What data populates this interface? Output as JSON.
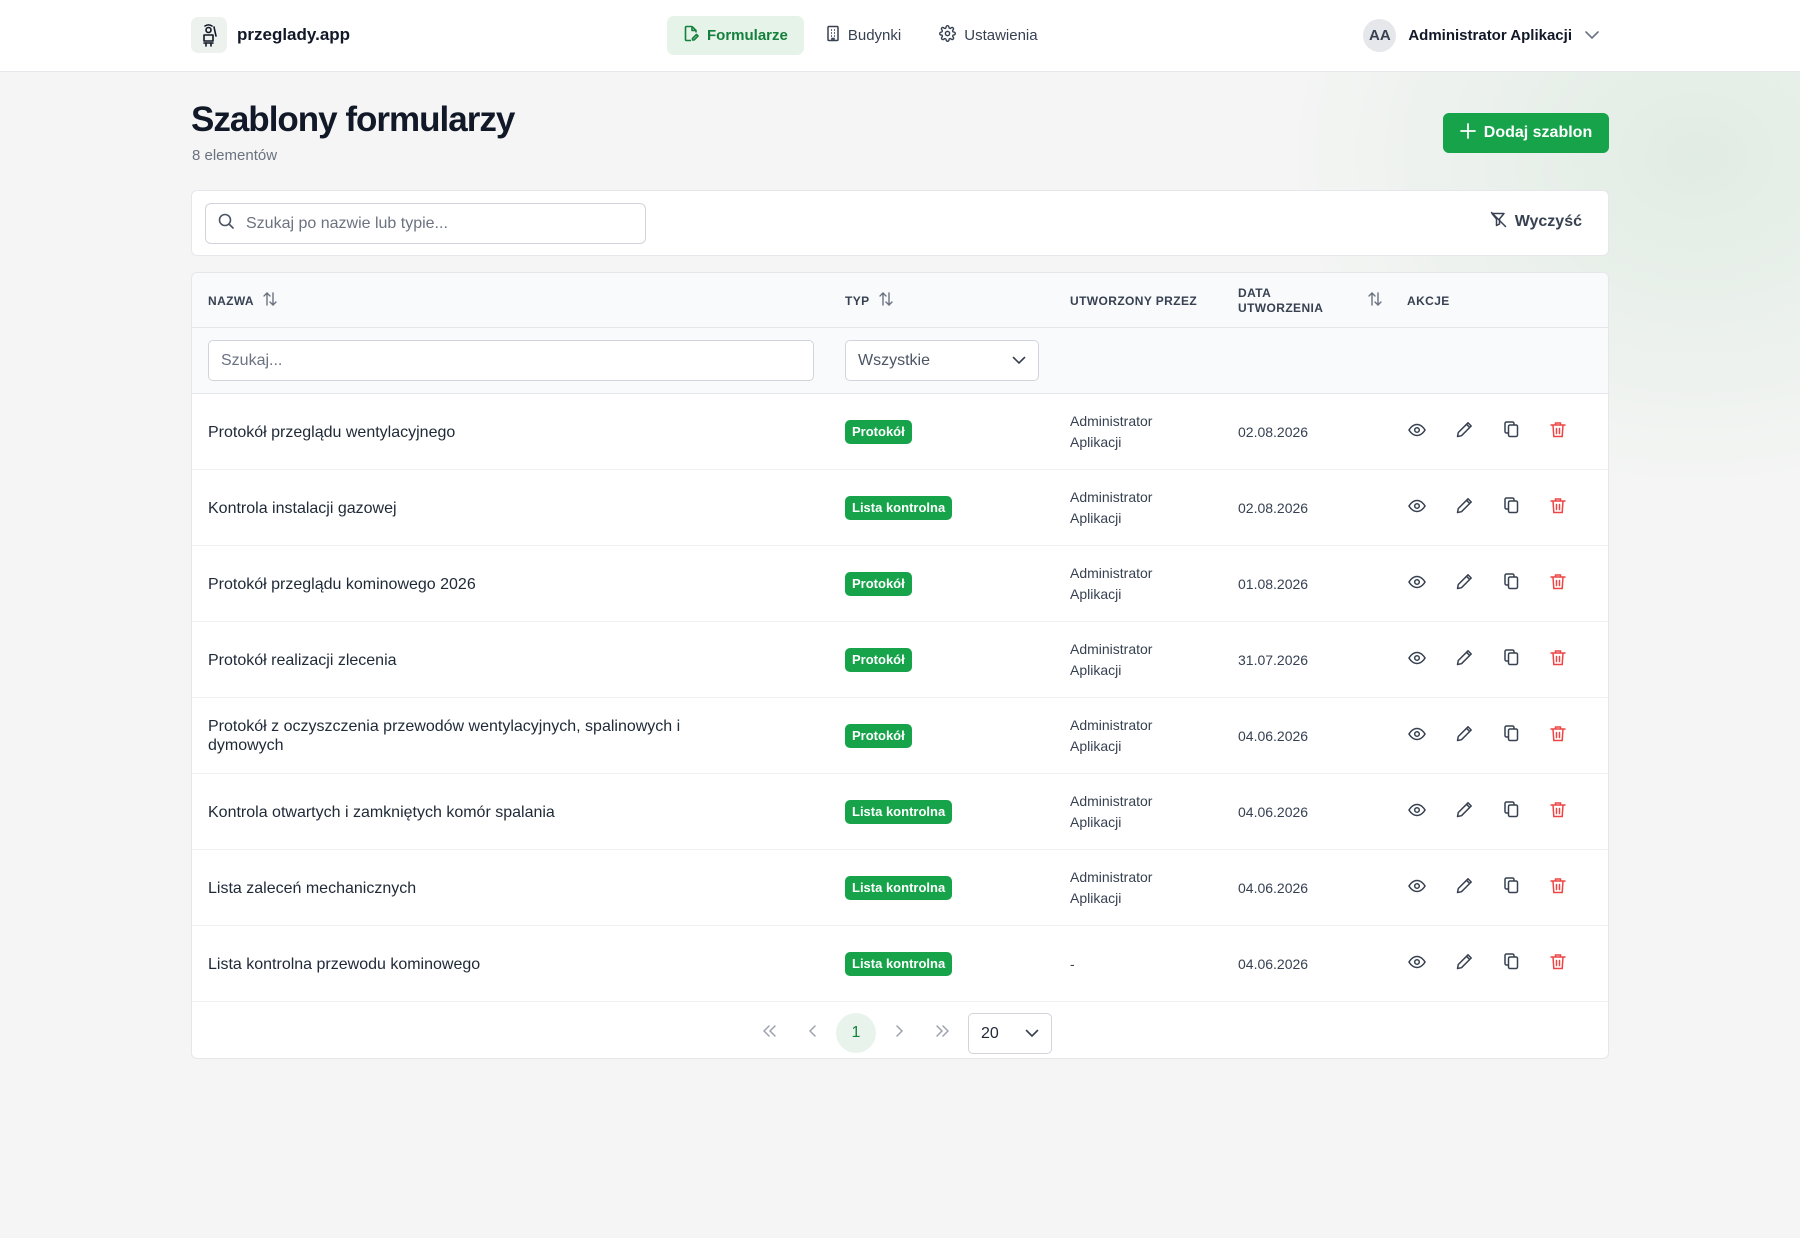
{
  "app": {
    "name": "przeglady.app"
  },
  "nav": [
    {
      "label": "Formularze",
      "icon": "file-edit-icon",
      "active": true
    },
    {
      "label": "Budynki",
      "icon": "building-icon",
      "active": false
    },
    {
      "label": "Ustawienia",
      "icon": "gear-icon",
      "active": false
    }
  ],
  "user": {
    "initials": "AA",
    "name": "Administrator Aplikacji"
  },
  "page": {
    "title": "Szablony formularzy",
    "count_text": "8 elementów"
  },
  "actions": {
    "add_label": "Dodaj szablon",
    "clear_label": "Wyczyść"
  },
  "search": {
    "placeholder": "Szukaj po nazwie lub typie..."
  },
  "table": {
    "headers": {
      "name": "NAZWA",
      "type": "TYP",
      "created_by": "UTWORZONY PRZEZ",
      "created_date_1": "DATA",
      "created_date_2": "UTWORZENIA",
      "actions": "AKCJE"
    },
    "filters": {
      "name_placeholder": "Szukaj...",
      "type_value": "Wszystkie"
    },
    "rows": [
      {
        "name": "Protokół przeglądu wentylacyjnego",
        "type": "Protokół",
        "by1": "Administrator",
        "by2": "Aplikacji",
        "date": "02.08.2026"
      },
      {
        "name": "Kontrola instalacji gazowej",
        "type": "Lista kontrolna",
        "by1": "Administrator",
        "by2": "Aplikacji",
        "date": "02.08.2026"
      },
      {
        "name": "Protokół przeglądu kominowego 2026",
        "type": "Protokół",
        "by1": "Administrator",
        "by2": "Aplikacji",
        "date": "01.08.2026"
      },
      {
        "name": "Protokół realizacji zlecenia",
        "type": "Protokół",
        "by1": "Administrator",
        "by2": "Aplikacji",
        "date": "31.07.2026"
      },
      {
        "name": "Protokół z oczyszczenia przewodów wentylacyjnych, spalinowych i dymowych",
        "type": "Protokół",
        "by1": "Administrator",
        "by2": "Aplikacji",
        "date": "04.06.2026"
      },
      {
        "name": "Kontrola otwartych i zamkniętych komór spalania",
        "type": "Lista kontrolna",
        "by1": "Administrator",
        "by2": "Aplikacji",
        "date": "04.06.2026"
      },
      {
        "name": "Lista zaleceń mechanicznych",
        "type": "Lista kontrolna",
        "by1": "Administrator",
        "by2": "Aplikacji",
        "date": "04.06.2026"
      },
      {
        "name": "Lista kontrolna przewodu kominowego",
        "type": "Lista kontrolna",
        "by1": "-",
        "by2": "",
        "date": "04.06.2026"
      }
    ]
  },
  "pagination": {
    "current_page": "1",
    "page_size": "20"
  },
  "colors": {
    "accent": "#16a34a",
    "danger": "#ef4444"
  }
}
